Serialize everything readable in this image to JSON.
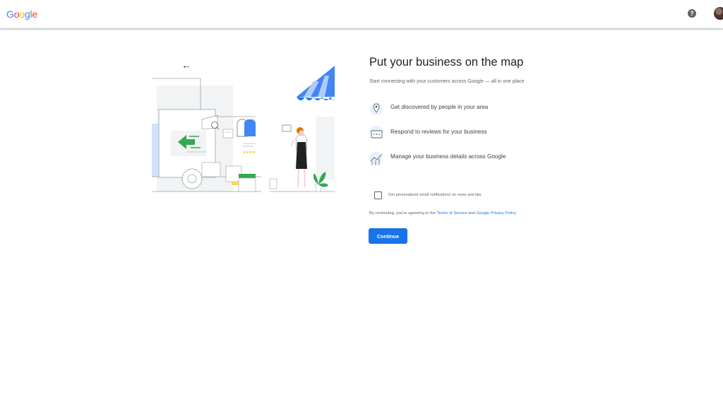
{
  "header": {
    "logo_letters": [
      {
        "ch": "G",
        "color": "#4285F4"
      },
      {
        "ch": "o",
        "color": "#EA4335"
      },
      {
        "ch": "o",
        "color": "#FBBC05"
      },
      {
        "ch": "g",
        "color": "#4285F4"
      },
      {
        "ch": "l",
        "color": "#34A853"
      },
      {
        "ch": "e",
        "color": "#EA4335"
      }
    ],
    "help_glyph": "?"
  },
  "illustration": {
    "back_glyph": "←"
  },
  "main": {
    "title": "Put your business on the map",
    "subtitle": "Start connecting with your customers across Google — all in one place",
    "features": [
      {
        "icon": "location-pin-icon",
        "text": "Get discovered by people in your area"
      },
      {
        "icon": "review-chat-icon",
        "text": "Respond to reviews for your business"
      },
      {
        "icon": "analytics-chart-icon",
        "text": "Manage your business details across Google"
      }
    ],
    "checkbox_label": "Get personalized email notifications on news and tips",
    "checkbox_checked": false,
    "terms": {
      "prefix": "By continuing, you're agreeing to the ",
      "tos": "Terms of Service",
      "and": " and ",
      "privacy": "Google Privacy Policy"
    },
    "continue_label": "Continue"
  },
  "colors": {
    "accent": "#1a73e8",
    "green": "#34a853",
    "awning_blue": "#4285f4"
  }
}
